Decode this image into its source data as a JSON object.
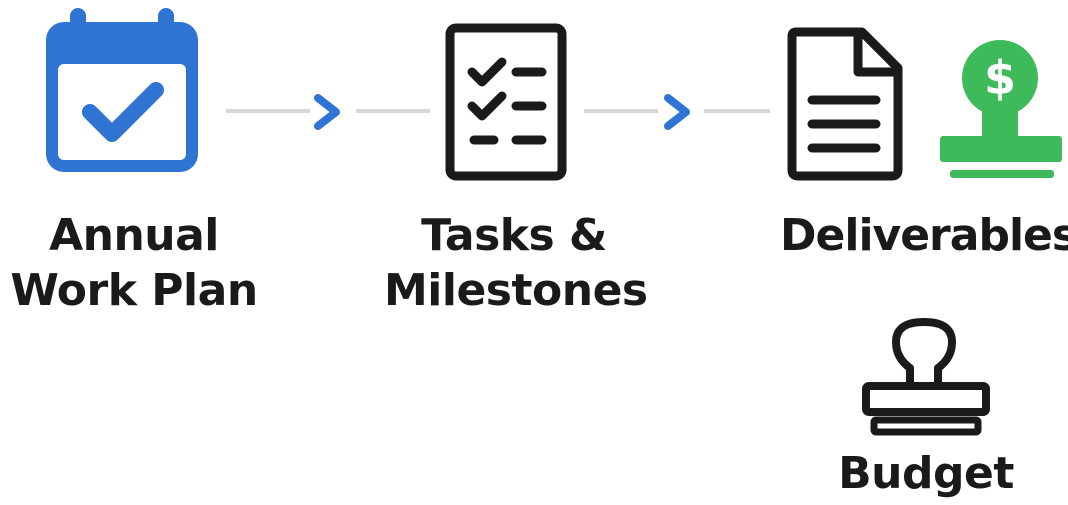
{
  "steps": [
    {
      "label_lines": [
        "Annual",
        "Work Plan"
      ],
      "icon": "calendar-check-icon"
    },
    {
      "label_lines": [
        "Tasks &",
        "Milestones"
      ],
      "icon": "checklist-icon"
    },
    {
      "label_lines": [
        "Deliverables"
      ],
      "icon": "document-icon"
    }
  ],
  "budget": {
    "label": "Budget",
    "icon": "stamp-icon"
  },
  "extra_icon": {
    "icon": "dollar-stamp-icon"
  },
  "colors": {
    "blue": "#2f73d3",
    "green": "#3fba5a",
    "ink": "#1a1a1a",
    "connector": "#d6d6d6",
    "arrow": "#2f73d3"
  }
}
